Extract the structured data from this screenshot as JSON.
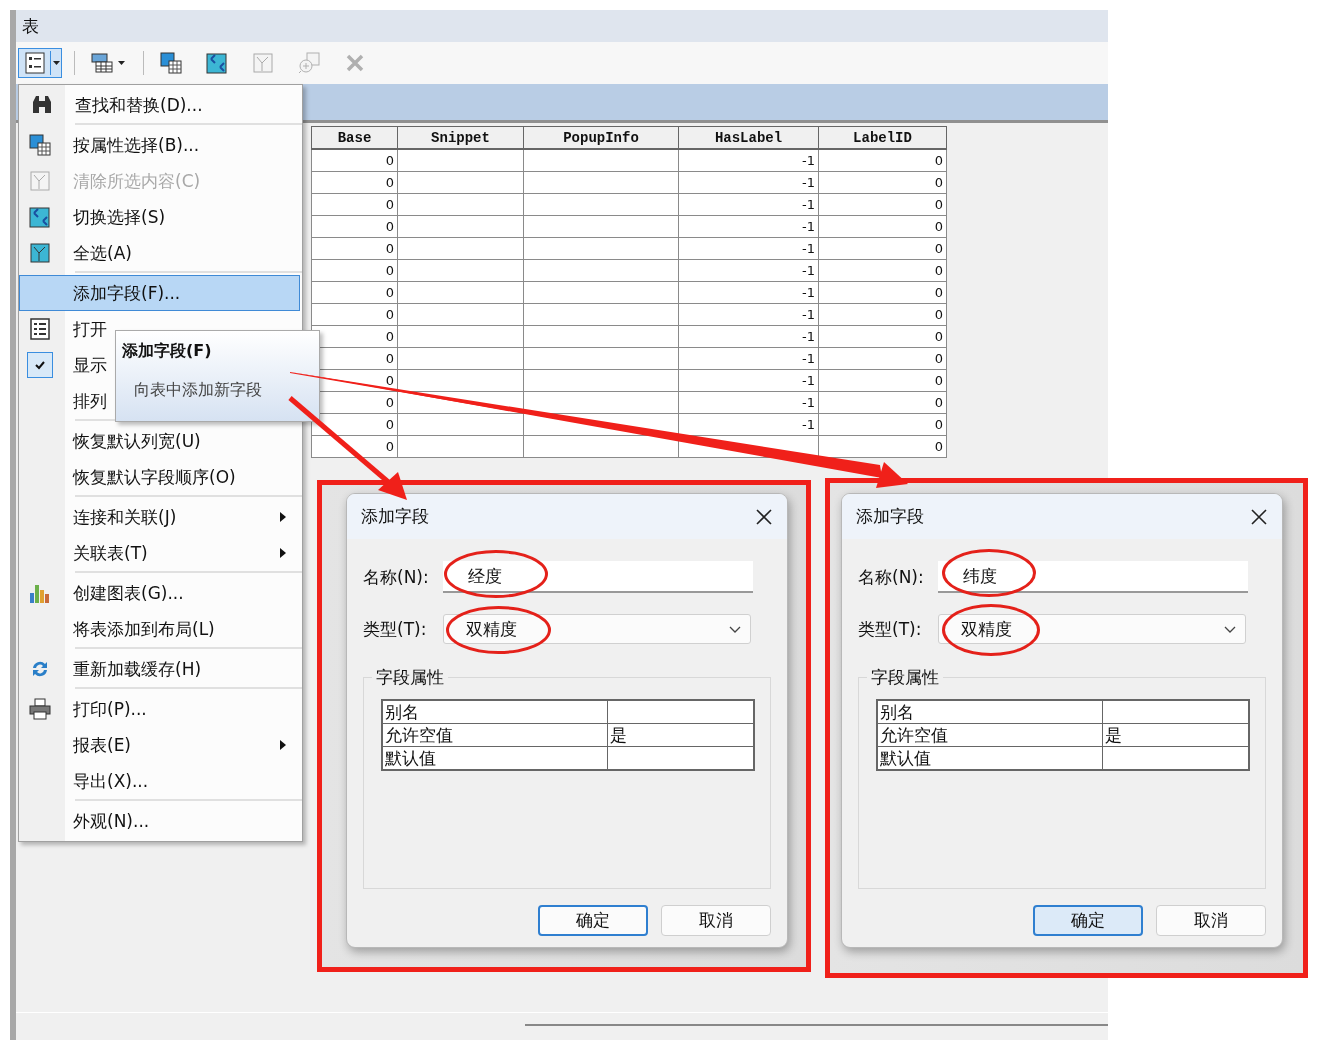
{
  "window": {
    "title": "表"
  },
  "toolbar": {
    "buttons": [
      {
        "kind": "table-options",
        "selected": true,
        "disabled": false,
        "dropdown": true
      },
      {
        "kind": "add-table",
        "selected": false,
        "disabled": false,
        "dropdown": true
      },
      {
        "kind": "select-by-attributes",
        "selected": false,
        "disabled": false,
        "dropdown": false
      },
      {
        "kind": "switch-selection",
        "selected": false,
        "disabled": false,
        "dropdown": false
      },
      {
        "kind": "clear-selection",
        "selected": false,
        "disabled": true,
        "dropdown": false
      },
      {
        "kind": "zoom-to-selected",
        "selected": false,
        "disabled": true,
        "dropdown": false
      },
      {
        "kind": "delete",
        "selected": false,
        "disabled": true,
        "dropdown": false
      }
    ]
  },
  "table": {
    "columns": [
      "Base",
      "Snippet",
      "PopupInfo",
      "HasLabel",
      "LabelID"
    ],
    "rows": [
      {
        "base": "0",
        "has_label": "-1",
        "label_id": "0"
      },
      {
        "base": "0",
        "has_label": "-1",
        "label_id": "0"
      },
      {
        "base": "0",
        "has_label": "-1",
        "label_id": "0"
      },
      {
        "base": "0",
        "has_label": "-1",
        "label_id": "0"
      },
      {
        "base": "0",
        "has_label": "-1",
        "label_id": "0"
      },
      {
        "base": "0",
        "has_label": "-1",
        "label_id": "0"
      },
      {
        "base": "0",
        "has_label": "-1",
        "label_id": "0"
      },
      {
        "base": "0",
        "has_label": "-1",
        "label_id": "0"
      },
      {
        "base": "0",
        "has_label": "-1",
        "label_id": "0"
      },
      {
        "base": "0",
        "has_label": "-1",
        "label_id": "0"
      },
      {
        "base": "0",
        "has_label": "-1",
        "label_id": "0"
      },
      {
        "base": "0",
        "has_label": "-1",
        "label_id": "0"
      },
      {
        "base": "0",
        "has_label": "-1",
        "label_id": "0"
      },
      {
        "base": "0",
        "label_id": "0"
      }
    ]
  },
  "context_menu": {
    "groups": [
      [
        {
          "label": "查找和替换(D)...",
          "disabled": false,
          "selected": false,
          "submenu": false,
          "checked": false
        }
      ],
      [
        {
          "label": "按属性选择(B)...",
          "disabled": false,
          "selected": false,
          "submenu": false,
          "checked": false
        },
        {
          "label": "清除所选内容(C)",
          "disabled": true,
          "selected": false,
          "submenu": false,
          "checked": false
        },
        {
          "label": "切换选择(S)",
          "disabled": false,
          "selected": false,
          "submenu": false,
          "checked": false
        },
        {
          "label": "全选(A)",
          "disabled": false,
          "selected": false,
          "submenu": false,
          "checked": false
        }
      ],
      [
        {
          "label": "添加字段(F)...",
          "disabled": false,
          "selected": true,
          "submenu": false,
          "checked": false
        },
        {
          "label": "打开",
          "disabled": false,
          "selected": false,
          "submenu": false,
          "checked": false
        },
        {
          "label": "显示",
          "disabled": false,
          "selected": false,
          "submenu": false,
          "checked": true
        },
        {
          "label": "排列",
          "disabled": false,
          "selected": false,
          "checked": false
        }
      ],
      [
        {
          "label": "恢复默认列宽(U)",
          "disabled": false,
          "selected": false,
          "submenu": false,
          "checked": false
        },
        {
          "label": "恢复默认字段顺序(O)",
          "disabled": false,
          "selected": false,
          "submenu": false,
          "checked": false
        }
      ],
      [
        {
          "label": "连接和关联(J)",
          "disabled": false,
          "selected": false,
          "submenu": true,
          "checked": false
        },
        {
          "label": "关联表(T)",
          "disabled": false,
          "selected": false,
          "submenu": true,
          "checked": false
        }
      ],
      [
        {
          "label": "创建图表(G)...",
          "disabled": false,
          "selected": false,
          "submenu": false,
          "checked": false
        },
        {
          "label": "将表添加到布局(L)",
          "disabled": false,
          "selected": false,
          "submenu": false,
          "checked": false
        }
      ],
      [
        {
          "label": "重新加载缓存(H)",
          "disabled": false,
          "selected": false,
          "submenu": false,
          "checked": false
        }
      ],
      [
        {
          "label": "打印(P)...",
          "disabled": false,
          "selected": false,
          "submenu": false,
          "checked": false
        },
        {
          "label": "报表(E)",
          "disabled": false,
          "selected": false,
          "submenu": true,
          "checked": false
        },
        {
          "label": "导出(X)...",
          "disabled": false,
          "selected": false,
          "submenu": false,
          "checked": false
        }
      ],
      [
        {
          "label": "外观(N)...",
          "disabled": false,
          "selected": false,
          "submenu": false,
          "checked": false
        }
      ]
    ]
  },
  "tooltip": {
    "title": "添加字段(F)",
    "description": "向表中添加新字段"
  },
  "dialogs": [
    {
      "title": "添加字段",
      "name_label": "名称(N):",
      "name_value": "经度",
      "type_label": "类型(T):",
      "type_value": "双精度",
      "group_title": "字段属性",
      "properties": [
        {
          "name": "别名"
        },
        {
          "name": "允许空值",
          "value": "是"
        },
        {
          "name": "默认值"
        }
      ],
      "buttons": [
        {
          "label": "确定",
          "kind": "default",
          "highlighted": false
        },
        {
          "label": "取消",
          "kind": "normal",
          "highlighted": false
        }
      ]
    },
    {
      "title": "添加字段",
      "name_label": "名称(N):",
      "name_value": "纬度",
      "type_label": "类型(T):",
      "type_value": "双精度",
      "group_title": "字段属性",
      "properties": [
        {
          "name": "别名"
        },
        {
          "name": "允许空值",
          "value": "是"
        },
        {
          "name": "默认值"
        }
      ],
      "buttons": [
        {
          "label": "确定",
          "kind": "default",
          "highlighted": true
        },
        {
          "label": "取消",
          "kind": "normal",
          "highlighted": false
        }
      ]
    }
  ]
}
